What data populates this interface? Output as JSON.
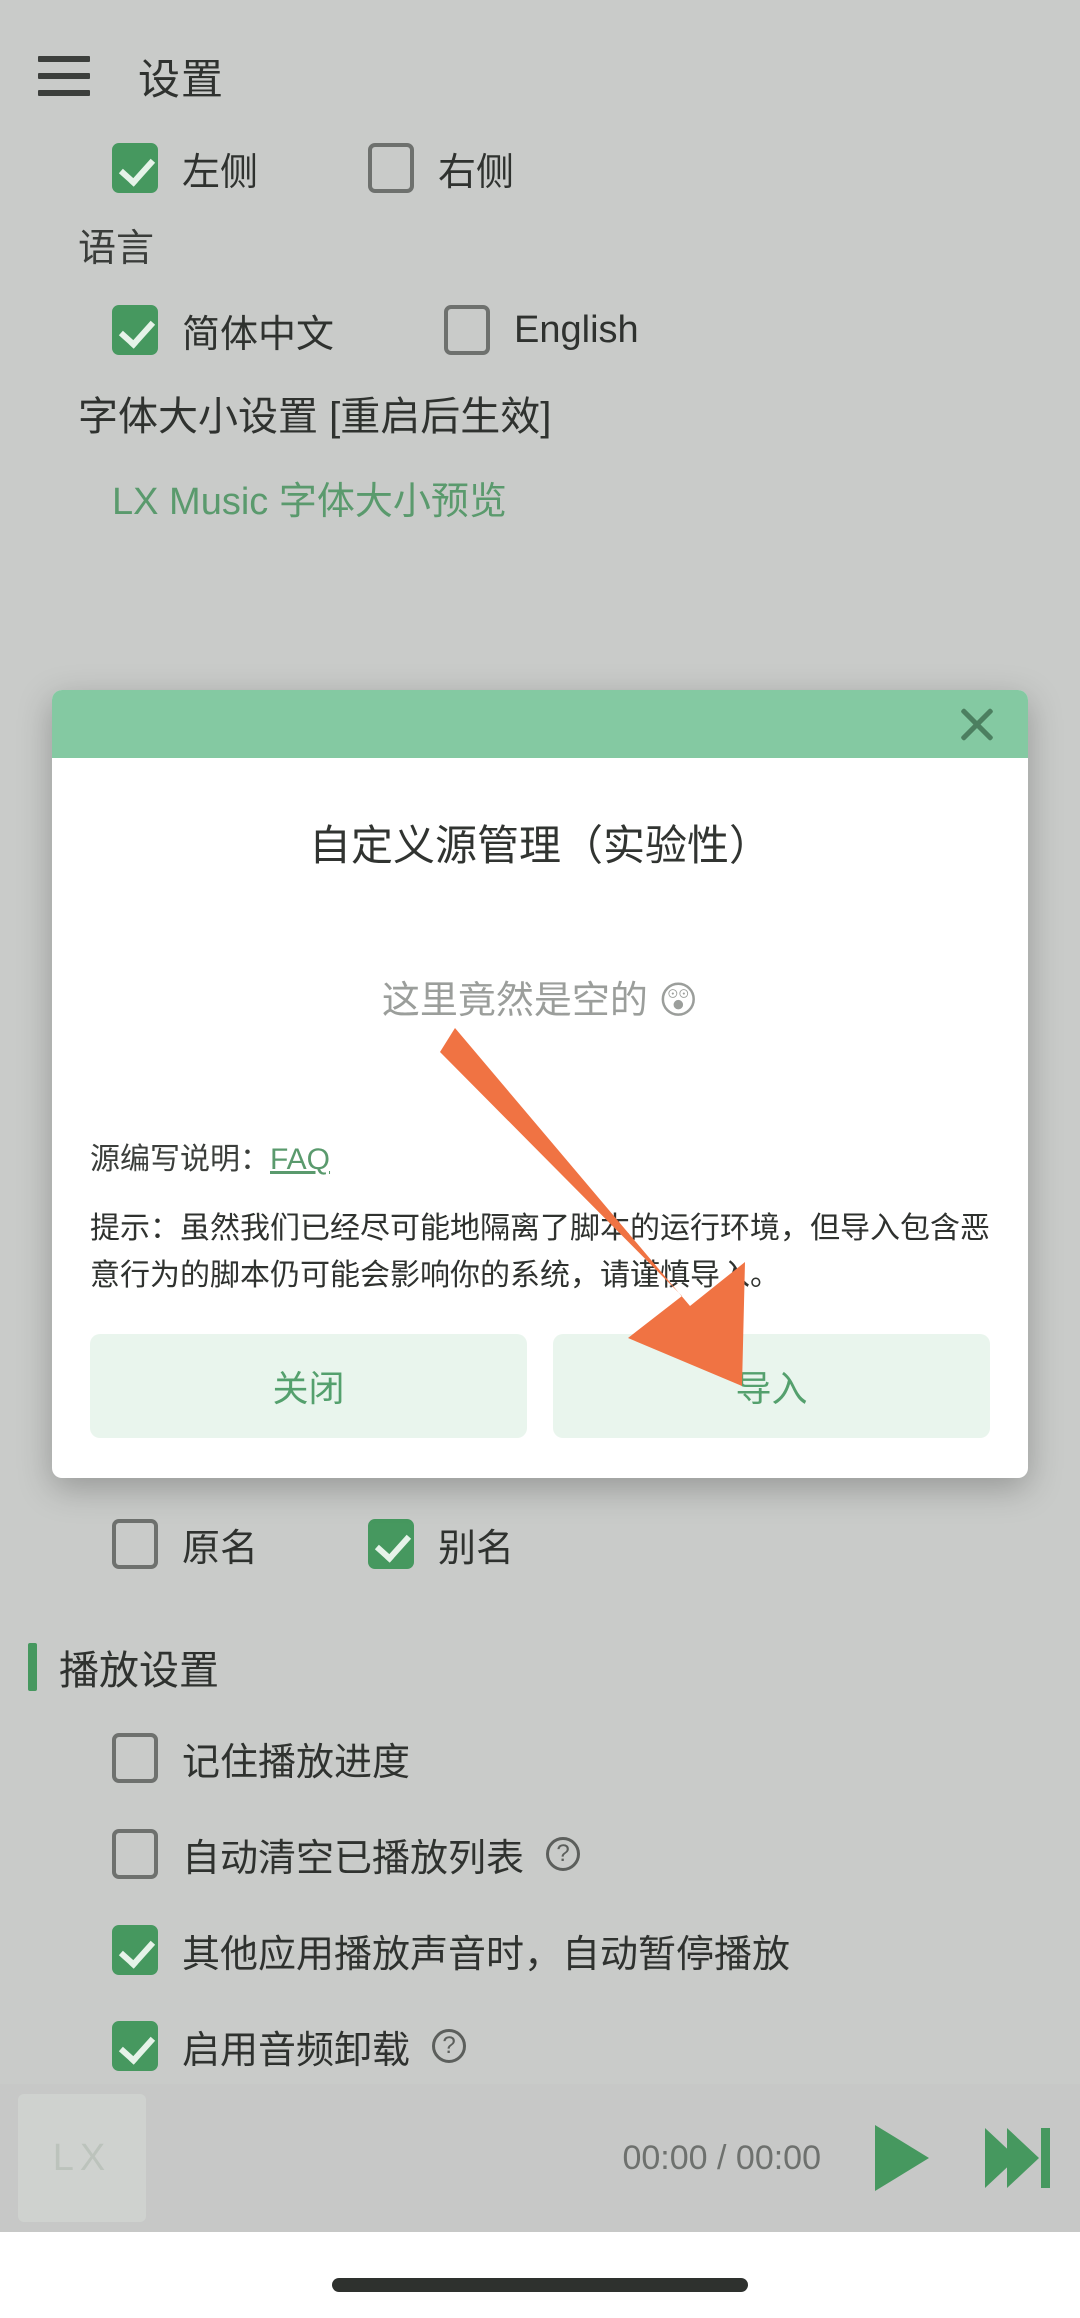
{
  "appbar": {
    "menu_icon": "hamburger-menu-icon",
    "title": "设置"
  },
  "settings": {
    "lyric_position": {
      "options": [
        {
          "label": "左侧",
          "checked": true
        },
        {
          "label": "右侧",
          "checked": false
        }
      ]
    },
    "language_section": {
      "label": "语言",
      "options": [
        {
          "label": "简体中文",
          "checked": true
        },
        {
          "label": "English",
          "checked": false
        }
      ]
    },
    "font_size_section": {
      "label": "字体大小设置 [重启后生效]",
      "preview": "LX Music 字体大小预览"
    },
    "name_display": {
      "options": [
        {
          "label": "原名",
          "checked": false
        },
        {
          "label": "别名",
          "checked": true
        }
      ]
    },
    "playback_section": {
      "heading": "播放设置",
      "items": [
        {
          "label": "记住播放进度",
          "checked": false,
          "help": false
        },
        {
          "label": "自动清空已播放列表",
          "checked": false,
          "help": true
        },
        {
          "label": "其他应用播放声音时，自动暂停播放",
          "checked": true,
          "help": false
        },
        {
          "label": "启用音频卸载",
          "checked": true,
          "help": true
        }
      ]
    }
  },
  "dialog": {
    "close_icon": "close-icon",
    "title": "自定义源管理（实验性）",
    "empty_text": "这里竟然是空的",
    "empty_emoji": "😲",
    "faq_prefix": "源编写说明：",
    "faq_link": "FAQ",
    "warning": "提示：虽然我们已经尽可能地隔离了脚本的运行环境，但导入包含恶意行为的脚本仍可能会影响你的系统，请谨慎导入。",
    "close_button": "关闭",
    "import_button": "导入"
  },
  "annotation": {
    "arrow_color": "#f07343",
    "points_to": "import-button"
  },
  "player": {
    "album_placeholder": "LX",
    "time": "00:00 / 00:00",
    "play_icon": "play-icon",
    "next_icon": "next-track-icon"
  },
  "colors": {
    "accent_green": "#46985f",
    "header_green": "#84c9a2",
    "page_bg": "#c9cbc9",
    "button_bg": "#e9f5ed",
    "annotation_orange": "#f07343"
  },
  "help_glyph": "?"
}
